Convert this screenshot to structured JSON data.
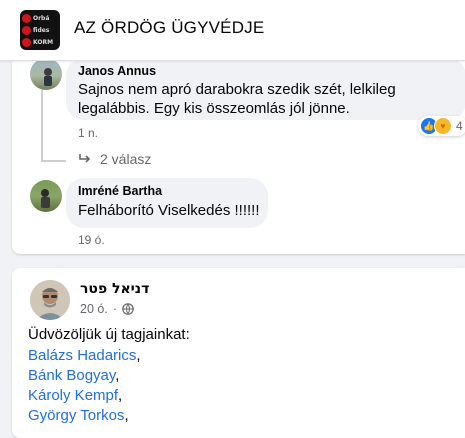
{
  "header": {
    "group_name": "AZ ÖRDÖG ÜGYVÉDJE",
    "thumb_rows": [
      "Orbá",
      "fides",
      "KORM"
    ]
  },
  "comments": [
    {
      "author": "Janos Annus",
      "text_line1": "Sajnos nem apró darabokra szedik szét, lelkileg",
      "text_line2": "legalábbis. Egy kis összeomlás jól jönne.",
      "time": "1 n.",
      "reaction_count": "4",
      "replies": "2 válasz"
    },
    {
      "author": "Imréné Bartha",
      "text": "Felháborító Viselkedés !!!!!!",
      "time": "19 ó."
    }
  ],
  "post": {
    "author": "דניאל פטר",
    "time": "20 ó.",
    "greeting": "Üdvözöljük új tagjainkat:",
    "members": [
      "Balázs Hadarics",
      "Bánk Bogyay",
      "Károly Kempf",
      "György Torkos"
    ]
  },
  "colors": {
    "link": "#216fdb",
    "secondary": "#65676b",
    "bubble": "#f0f2f5",
    "page_bg": "#f0f2f5"
  }
}
